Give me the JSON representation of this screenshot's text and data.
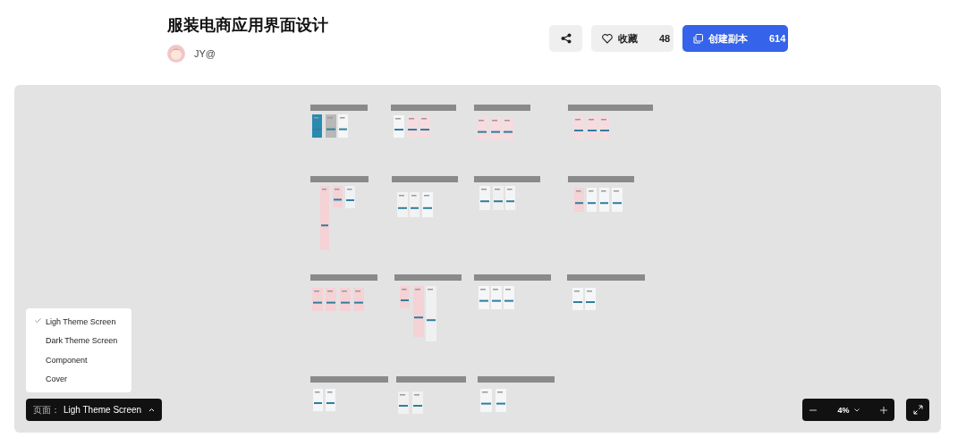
{
  "header": {
    "title": "服装电商应用界面设计",
    "author": "JY@"
  },
  "actions": {
    "favorite": {
      "label": "收藏",
      "count": "48"
    },
    "duplicate": {
      "label": "创建副本",
      "count": "614"
    }
  },
  "pages_menu": {
    "open": true,
    "items": [
      {
        "label": "Ligh Theme Screen",
        "selected": true
      },
      {
        "label": "Dark Theme Screen",
        "selected": false
      },
      {
        "label": "Component",
        "selected": false
      },
      {
        "label": "Cover",
        "selected": false
      }
    ]
  },
  "page_selector": {
    "prefix": "页面：",
    "value": "Ligh Theme Screen"
  },
  "zoom": {
    "value": "4%"
  }
}
